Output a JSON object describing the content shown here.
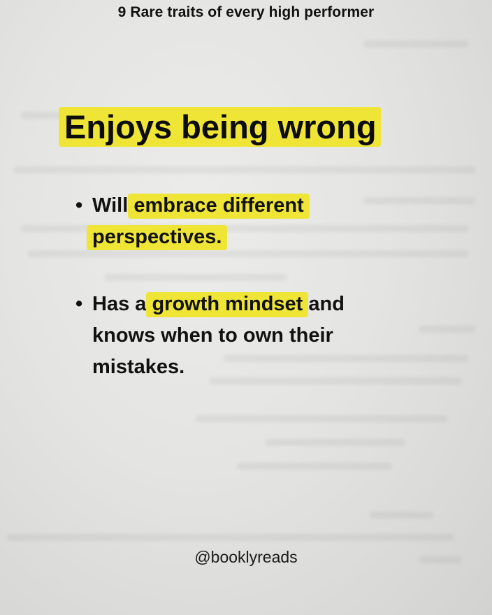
{
  "header": {
    "text": "9 Rare traits of every high performer"
  },
  "title": {
    "text": "Enjoys being wrong"
  },
  "bullets": [
    {
      "bullet_char": "•",
      "before": "Will ",
      "highlight": "embrace different perspectives.",
      "after": ""
    },
    {
      "bullet_char": "•",
      "before": "Has a ",
      "highlight": "growth mindset",
      "after": " and knows when to own their mistakes."
    }
  ],
  "footer": {
    "handle": "@booklyreads"
  },
  "colors": {
    "highlight": "#efe536",
    "text": "#0d0d0d",
    "paper": "#e4e4e2"
  }
}
